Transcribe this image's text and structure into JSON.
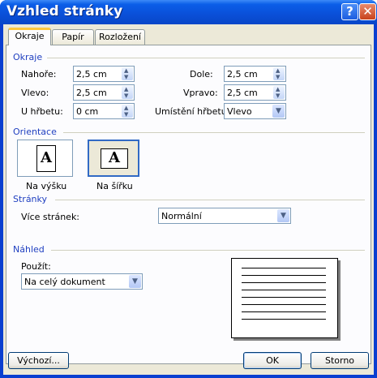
{
  "window": {
    "title": "Vzhled stránky",
    "help_glyph": "?",
    "close_glyph": "✕"
  },
  "tabs": [
    {
      "label": "Okraje",
      "active": true
    },
    {
      "label": "Papír",
      "active": false
    },
    {
      "label": "Rozložení",
      "active": false
    }
  ],
  "margins": {
    "heading": "Okraje",
    "top_label": "Nahoře:",
    "top_value": "2,5 cm",
    "bottom_label": "Dole:",
    "bottom_value": "2,5 cm",
    "left_label": "Vlevo:",
    "left_value": "2,5 cm",
    "right_label": "Vpravo:",
    "right_value": "2,5 cm",
    "gutter_label": "U hřbetu:",
    "gutter_value": "0 cm",
    "gutter_pos_label": "Umístění hřbetu:",
    "gutter_pos_value": "Vlevo"
  },
  "orientation": {
    "heading": "Orientace",
    "portrait_label": "Na výšku",
    "landscape_label": "Na šířku",
    "icon_letter": "A",
    "selected": "landscape"
  },
  "pages": {
    "heading": "Stránky",
    "multiple_label": "Více stránek:",
    "multiple_value": "Normální"
  },
  "preview": {
    "heading": "Náhled",
    "apply_label": "Použít:",
    "apply_value": "Na celý dokument"
  },
  "buttons": {
    "default_label": "Výchozí...",
    "ok_label": "OK",
    "cancel_label": "Storno"
  }
}
